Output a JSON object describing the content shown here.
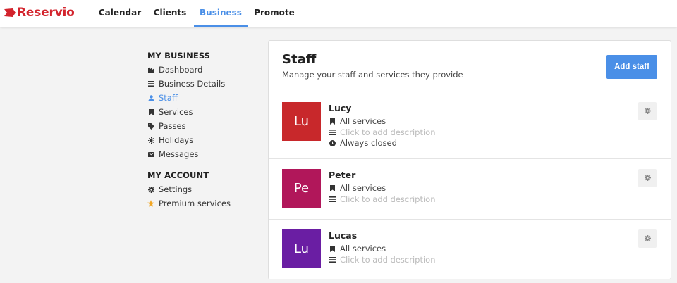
{
  "brand": {
    "name": "Reservio",
    "color": "#d3242d"
  },
  "nav": {
    "calendar": "Calendar",
    "clients": "Clients",
    "business": "Business",
    "promote": "Promote",
    "active": "Business"
  },
  "sidebar": {
    "my_business": {
      "heading": "MY BUSINESS",
      "items": [
        {
          "label": "Dashboard",
          "icon": "dashboard-icon"
        },
        {
          "label": "Business Details",
          "icon": "list-icon"
        },
        {
          "label": "Staff",
          "icon": "user-icon",
          "active": true
        },
        {
          "label": "Services",
          "icon": "bookmark-icon"
        },
        {
          "label": "Passes",
          "icon": "tag-icon"
        },
        {
          "label": "Holidays",
          "icon": "sun-icon"
        },
        {
          "label": "Messages",
          "icon": "envelope-icon"
        }
      ]
    },
    "my_account": {
      "heading": "MY ACCOUNT",
      "items": [
        {
          "label": "Settings",
          "icon": "gear-icon"
        },
        {
          "label": "Premium services",
          "icon": "star-icon"
        }
      ]
    }
  },
  "main": {
    "title": "Staff",
    "subtitle": "Manage your staff and services they provide",
    "add_button": "Add staff",
    "staff": [
      {
        "initials": "Lu",
        "name": "Lucy",
        "color": "#c8282b",
        "services": "All services",
        "description_placeholder": "Click to add description",
        "hours": "Always closed"
      },
      {
        "initials": "Pe",
        "name": "Peter",
        "color": "#b1175a",
        "services": "All services",
        "description_placeholder": "Click to add description"
      },
      {
        "initials": "Lu",
        "name": "Lucas",
        "color": "#6a1ea3",
        "services": "All services",
        "description_placeholder": "Click to add description"
      }
    ]
  },
  "colors": {
    "accent": "#4a8fe7",
    "background": "#f3f3f3"
  }
}
